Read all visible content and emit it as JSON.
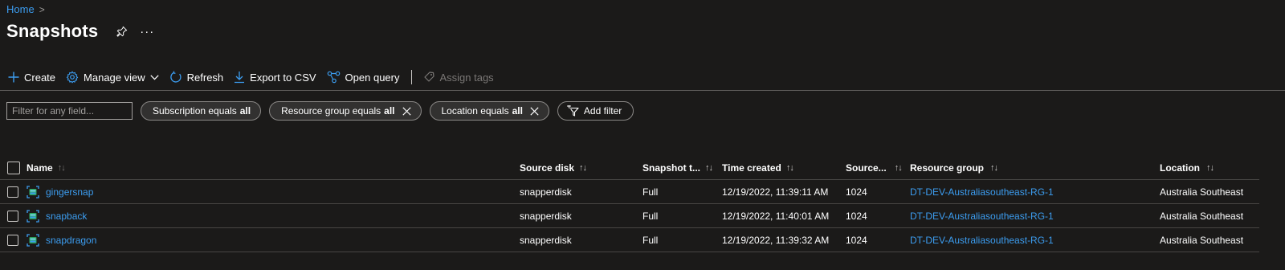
{
  "breadcrumb": {
    "home": "Home",
    "separator": ">"
  },
  "page": {
    "title": "Snapshots",
    "more": "···"
  },
  "toolbar": {
    "create": "Create",
    "manage_view": "Manage view",
    "refresh": "Refresh",
    "export_csv": "Export to CSV",
    "open_query": "Open query",
    "assign_tags": "Assign tags"
  },
  "filters": {
    "placeholder": "Filter for any field...",
    "subscription": {
      "label": "Subscription equals",
      "value": "all"
    },
    "resource_group": {
      "label": "Resource group equals",
      "value": "all"
    },
    "location": {
      "label": "Location equals",
      "value": "all"
    },
    "add_filter": "Add filter"
  },
  "table": {
    "columns": {
      "name": "Name",
      "source_disk": "Source disk",
      "snapshot_type": "Snapshot t...",
      "time_created": "Time created",
      "source_size": "Source...",
      "resource_group": "Resource group",
      "location": "Location"
    },
    "sort_icon": "↑↓",
    "rows": [
      {
        "name": "gingersnap",
        "source_disk": "snapperdisk",
        "snapshot_type": "Full",
        "time_created": "12/19/2022, 11:39:11 AM",
        "source_size": "1024",
        "resource_group": "DT-DEV-Australiasoutheast-RG-1",
        "location": "Australia Southeast"
      },
      {
        "name": "snapback",
        "source_disk": "snapperdisk",
        "snapshot_type": "Full",
        "time_created": "12/19/2022, 11:40:01 AM",
        "source_size": "1024",
        "resource_group": "DT-DEV-Australiasoutheast-RG-1",
        "location": "Australia Southeast"
      },
      {
        "name": "snapdragon",
        "source_disk": "snapperdisk",
        "snapshot_type": "Full",
        "time_created": "12/19/2022, 11:39:32 AM",
        "source_size": "1024",
        "resource_group": "DT-DEV-Australiasoutheast-RG-1",
        "location": "Australia Southeast"
      }
    ]
  },
  "colors": {
    "background": "#1b1a19",
    "link": "#3c9df0",
    "text": "#ffffff",
    "disabled": "#7a7775"
  }
}
